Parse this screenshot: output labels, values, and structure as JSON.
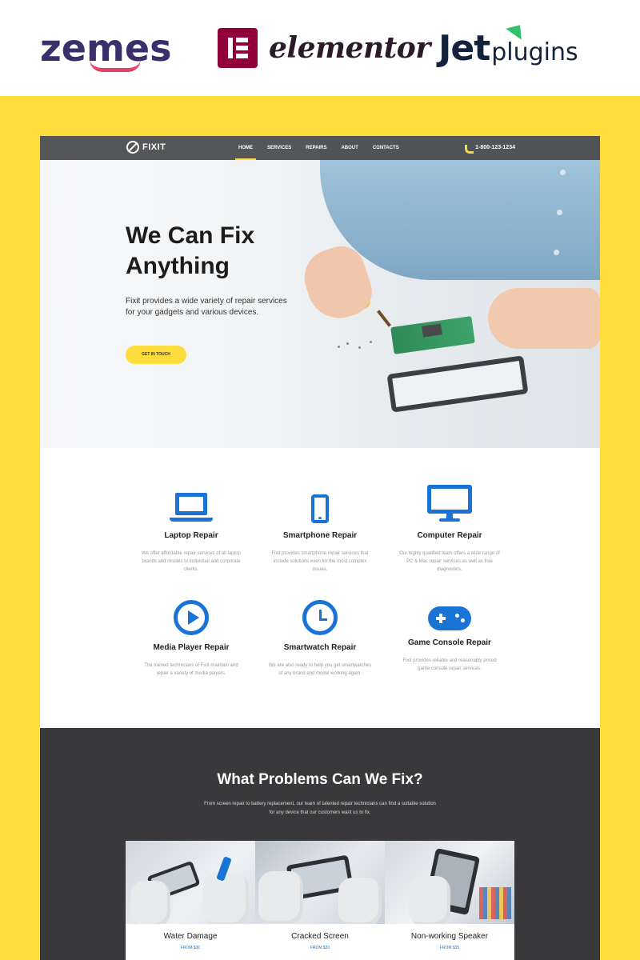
{
  "brands": {
    "zemes": "zemes",
    "elementor": "elementor",
    "jet": "Jet",
    "plugins": "plugins"
  },
  "nav": {
    "logo": "FIXIT",
    "items": [
      "HOME",
      "SERVICES",
      "REPAIRS",
      "ABOUT",
      "CONTACTS"
    ],
    "phone": "1-800-123-1234"
  },
  "hero": {
    "title": "We Can Fix Anything",
    "subtitle": "Fixit provides a wide variety of repair services for your gadgets and various devices.",
    "button": "GET IN TOUCH"
  },
  "services": [
    {
      "title": "Laptop Repair",
      "desc": "We offer affordable repair services of all laptop brands and models to individual and corporate clients.",
      "icon": "laptop-icon"
    },
    {
      "title": "Smartphone Repair",
      "desc": "Fixit provides smartphone repair services that include solutions even for the most complex issues.",
      "icon": "smartphone-icon"
    },
    {
      "title": "Computer Repair",
      "desc": "Our highly qualified team offers a wide range of PC & Mac repair services as well as free diagnostics.",
      "icon": "monitor-icon"
    },
    {
      "title": "Media Player Repair",
      "desc": "The trained technicians of Fixit maintain and repair a variety of media players.",
      "icon": "play-icon"
    },
    {
      "title": "Smartwatch Repair",
      "desc": "We are also ready to help you get smartwatches of any brand and model working again.",
      "icon": "clock-icon"
    },
    {
      "title": "Game Console Repair",
      "desc": "Fixit provides reliable and reasonably priced game console repair services.",
      "icon": "gamepad-icon"
    }
  ],
  "problems": {
    "title": "What Problems Can We Fix?",
    "subtitle": "From screen repair to battery replacement, our team of talented repair technicians can find a suitable solution for any device that our customers want us to fix.",
    "cards": [
      {
        "title": "Water Damage",
        "price": "FROM $30"
      },
      {
        "title": "Cracked Screen",
        "price": "FROM $30"
      },
      {
        "title": "Non-working Speaker",
        "price": "FROM $35"
      }
    ]
  },
  "colors": {
    "accent_yellow": "#fddc3b",
    "icon_blue": "#1a74d6",
    "dark_section": "#39393b",
    "nav_bg": "#4d4e50"
  }
}
